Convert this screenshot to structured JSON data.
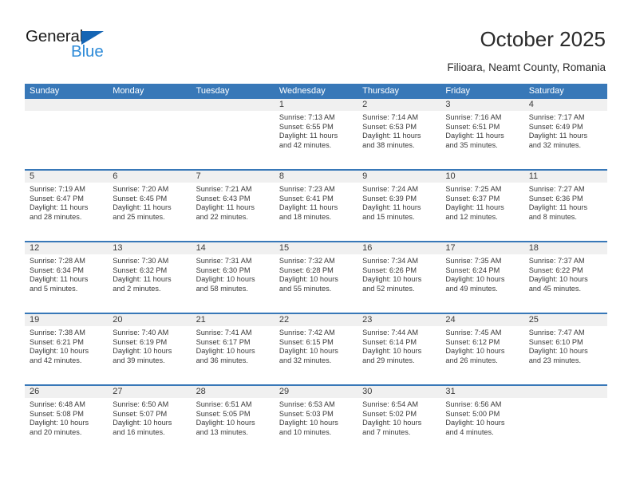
{
  "logo": {
    "word_one": "General",
    "word_two": "Blue",
    "triangle_icon": "triangle-icon",
    "accent_dark_blue": "#1565b4",
    "accent_light_blue": "#2e8bd8"
  },
  "header": {
    "title": "October 2025",
    "subtitle": "Filioara, Neamt County, Romania"
  },
  "theme": {
    "header_bg": "#3878b8",
    "band_bg": "#f0f0f0",
    "text": "#3a3a3a"
  },
  "calendar": {
    "weekdays": [
      "Sunday",
      "Monday",
      "Tuesday",
      "Wednesday",
      "Thursday",
      "Friday",
      "Saturday"
    ],
    "weeks": [
      [
        {
          "day": "",
          "sunrise": "",
          "sunset": "",
          "daylight_line1": "",
          "daylight_line2": ""
        },
        {
          "day": "",
          "sunrise": "",
          "sunset": "",
          "daylight_line1": "",
          "daylight_line2": ""
        },
        {
          "day": "",
          "sunrise": "",
          "sunset": "",
          "daylight_line1": "",
          "daylight_line2": ""
        },
        {
          "day": "1",
          "sunrise": "Sunrise: 7:13 AM",
          "sunset": "Sunset: 6:55 PM",
          "daylight_line1": "Daylight: 11 hours",
          "daylight_line2": "and 42 minutes."
        },
        {
          "day": "2",
          "sunrise": "Sunrise: 7:14 AM",
          "sunset": "Sunset: 6:53 PM",
          "daylight_line1": "Daylight: 11 hours",
          "daylight_line2": "and 38 minutes."
        },
        {
          "day": "3",
          "sunrise": "Sunrise: 7:16 AM",
          "sunset": "Sunset: 6:51 PM",
          "daylight_line1": "Daylight: 11 hours",
          "daylight_line2": "and 35 minutes."
        },
        {
          "day": "4",
          "sunrise": "Sunrise: 7:17 AM",
          "sunset": "Sunset: 6:49 PM",
          "daylight_line1": "Daylight: 11 hours",
          "daylight_line2": "and 32 minutes."
        }
      ],
      [
        {
          "day": "5",
          "sunrise": "Sunrise: 7:19 AM",
          "sunset": "Sunset: 6:47 PM",
          "daylight_line1": "Daylight: 11 hours",
          "daylight_line2": "and 28 minutes."
        },
        {
          "day": "6",
          "sunrise": "Sunrise: 7:20 AM",
          "sunset": "Sunset: 6:45 PM",
          "daylight_line1": "Daylight: 11 hours",
          "daylight_line2": "and 25 minutes."
        },
        {
          "day": "7",
          "sunrise": "Sunrise: 7:21 AM",
          "sunset": "Sunset: 6:43 PM",
          "daylight_line1": "Daylight: 11 hours",
          "daylight_line2": "and 22 minutes."
        },
        {
          "day": "8",
          "sunrise": "Sunrise: 7:23 AM",
          "sunset": "Sunset: 6:41 PM",
          "daylight_line1": "Daylight: 11 hours",
          "daylight_line2": "and 18 minutes."
        },
        {
          "day": "9",
          "sunrise": "Sunrise: 7:24 AM",
          "sunset": "Sunset: 6:39 PM",
          "daylight_line1": "Daylight: 11 hours",
          "daylight_line2": "and 15 minutes."
        },
        {
          "day": "10",
          "sunrise": "Sunrise: 7:25 AM",
          "sunset": "Sunset: 6:37 PM",
          "daylight_line1": "Daylight: 11 hours",
          "daylight_line2": "and 12 minutes."
        },
        {
          "day": "11",
          "sunrise": "Sunrise: 7:27 AM",
          "sunset": "Sunset: 6:36 PM",
          "daylight_line1": "Daylight: 11 hours",
          "daylight_line2": "and 8 minutes."
        }
      ],
      [
        {
          "day": "12",
          "sunrise": "Sunrise: 7:28 AM",
          "sunset": "Sunset: 6:34 PM",
          "daylight_line1": "Daylight: 11 hours",
          "daylight_line2": "and 5 minutes."
        },
        {
          "day": "13",
          "sunrise": "Sunrise: 7:30 AM",
          "sunset": "Sunset: 6:32 PM",
          "daylight_line1": "Daylight: 11 hours",
          "daylight_line2": "and 2 minutes."
        },
        {
          "day": "14",
          "sunrise": "Sunrise: 7:31 AM",
          "sunset": "Sunset: 6:30 PM",
          "daylight_line1": "Daylight: 10 hours",
          "daylight_line2": "and 58 minutes."
        },
        {
          "day": "15",
          "sunrise": "Sunrise: 7:32 AM",
          "sunset": "Sunset: 6:28 PM",
          "daylight_line1": "Daylight: 10 hours",
          "daylight_line2": "and 55 minutes."
        },
        {
          "day": "16",
          "sunrise": "Sunrise: 7:34 AM",
          "sunset": "Sunset: 6:26 PM",
          "daylight_line1": "Daylight: 10 hours",
          "daylight_line2": "and 52 minutes."
        },
        {
          "day": "17",
          "sunrise": "Sunrise: 7:35 AM",
          "sunset": "Sunset: 6:24 PM",
          "daylight_line1": "Daylight: 10 hours",
          "daylight_line2": "and 49 minutes."
        },
        {
          "day": "18",
          "sunrise": "Sunrise: 7:37 AM",
          "sunset": "Sunset: 6:22 PM",
          "daylight_line1": "Daylight: 10 hours",
          "daylight_line2": "and 45 minutes."
        }
      ],
      [
        {
          "day": "19",
          "sunrise": "Sunrise: 7:38 AM",
          "sunset": "Sunset: 6:21 PM",
          "daylight_line1": "Daylight: 10 hours",
          "daylight_line2": "and 42 minutes."
        },
        {
          "day": "20",
          "sunrise": "Sunrise: 7:40 AM",
          "sunset": "Sunset: 6:19 PM",
          "daylight_line1": "Daylight: 10 hours",
          "daylight_line2": "and 39 minutes."
        },
        {
          "day": "21",
          "sunrise": "Sunrise: 7:41 AM",
          "sunset": "Sunset: 6:17 PM",
          "daylight_line1": "Daylight: 10 hours",
          "daylight_line2": "and 36 minutes."
        },
        {
          "day": "22",
          "sunrise": "Sunrise: 7:42 AM",
          "sunset": "Sunset: 6:15 PM",
          "daylight_line1": "Daylight: 10 hours",
          "daylight_line2": "and 32 minutes."
        },
        {
          "day": "23",
          "sunrise": "Sunrise: 7:44 AM",
          "sunset": "Sunset: 6:14 PM",
          "daylight_line1": "Daylight: 10 hours",
          "daylight_line2": "and 29 minutes."
        },
        {
          "day": "24",
          "sunrise": "Sunrise: 7:45 AM",
          "sunset": "Sunset: 6:12 PM",
          "daylight_line1": "Daylight: 10 hours",
          "daylight_line2": "and 26 minutes."
        },
        {
          "day": "25",
          "sunrise": "Sunrise: 7:47 AM",
          "sunset": "Sunset: 6:10 PM",
          "daylight_line1": "Daylight: 10 hours",
          "daylight_line2": "and 23 minutes."
        }
      ],
      [
        {
          "day": "26",
          "sunrise": "Sunrise: 6:48 AM",
          "sunset": "Sunset: 5:08 PM",
          "daylight_line1": "Daylight: 10 hours",
          "daylight_line2": "and 20 minutes."
        },
        {
          "day": "27",
          "sunrise": "Sunrise: 6:50 AM",
          "sunset": "Sunset: 5:07 PM",
          "daylight_line1": "Daylight: 10 hours",
          "daylight_line2": "and 16 minutes."
        },
        {
          "day": "28",
          "sunrise": "Sunrise: 6:51 AM",
          "sunset": "Sunset: 5:05 PM",
          "daylight_line1": "Daylight: 10 hours",
          "daylight_line2": "and 13 minutes."
        },
        {
          "day": "29",
          "sunrise": "Sunrise: 6:53 AM",
          "sunset": "Sunset: 5:03 PM",
          "daylight_line1": "Daylight: 10 hours",
          "daylight_line2": "and 10 minutes."
        },
        {
          "day": "30",
          "sunrise": "Sunrise: 6:54 AM",
          "sunset": "Sunset: 5:02 PM",
          "daylight_line1": "Daylight: 10 hours",
          "daylight_line2": "and 7 minutes."
        },
        {
          "day": "31",
          "sunrise": "Sunrise: 6:56 AM",
          "sunset": "Sunset: 5:00 PM",
          "daylight_line1": "Daylight: 10 hours",
          "daylight_line2": "and 4 minutes."
        },
        {
          "day": "",
          "sunrise": "",
          "sunset": "",
          "daylight_line1": "",
          "daylight_line2": ""
        }
      ]
    ]
  }
}
